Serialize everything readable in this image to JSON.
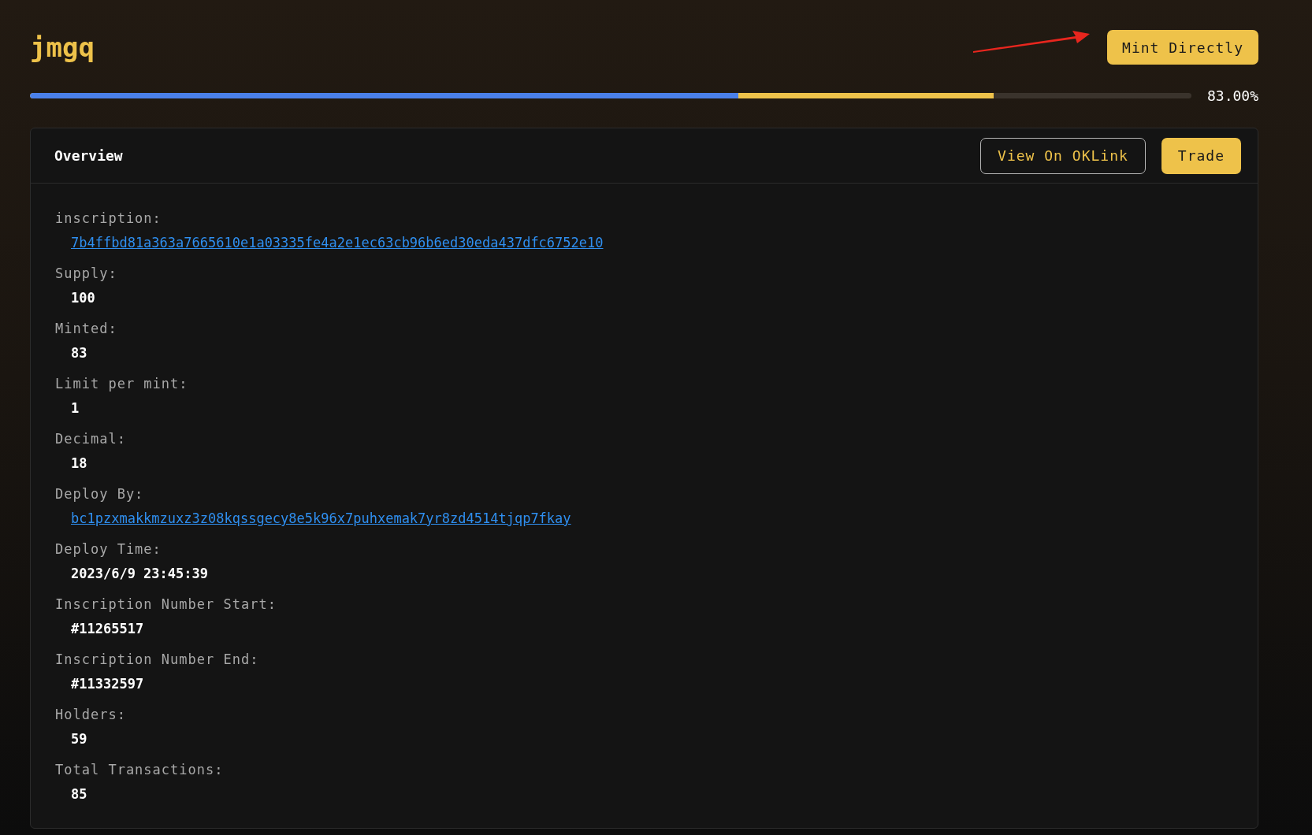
{
  "title": "jmgq",
  "mint_button": "Mint Directly",
  "progress": {
    "bars": [
      {
        "level": 0.61,
        "color": "#4a80ea"
      },
      {
        "level": 0.83,
        "color": "#eec24a"
      }
    ],
    "reading": "83.00%"
  },
  "overview": {
    "title": "Overview",
    "buttons": [
      {
        "label": "View On OKLink",
        "kind": "outline"
      },
      {
        "label": "Trade",
        "kind": "primary"
      }
    ],
    "fields": [
      {
        "label": "inscription:",
        "value": "7b4ffbd81a363a7665610e1a03335fe4a2e1ec63cb96b6ed30eda437dfc6752e10",
        "kind": "link"
      },
      {
        "label": "Supply:",
        "value": "100",
        "kind": "text"
      },
      {
        "label": "Minted:",
        "value": "83",
        "kind": "text"
      },
      {
        "label": "Limit per mint:",
        "value": "1",
        "kind": "text"
      },
      {
        "label": "Decimal:",
        "value": "18",
        "kind": "text"
      },
      {
        "label": "Deploy By:",
        "value": "bc1pzxmakkmzuxz3z08kqssgecy8e5k96x7puhxemak7yr8zd4514tjqp7fkay",
        "kind": "link"
      },
      {
        "label": "Deploy Time:",
        "value": "2023/6/9 23:45:39",
        "kind": "text"
      },
      {
        "label": "Inscription Number Start:",
        "value": "#11265517",
        "kind": "text"
      },
      {
        "label": "Inscription Number End:",
        "value": "#11332597",
        "kind": "text"
      },
      {
        "label": "Holders:",
        "value": "59",
        "kind": "text"
      },
      {
        "label": "Total Transactions:",
        "value": "85",
        "kind": "text"
      }
    ]
  }
}
